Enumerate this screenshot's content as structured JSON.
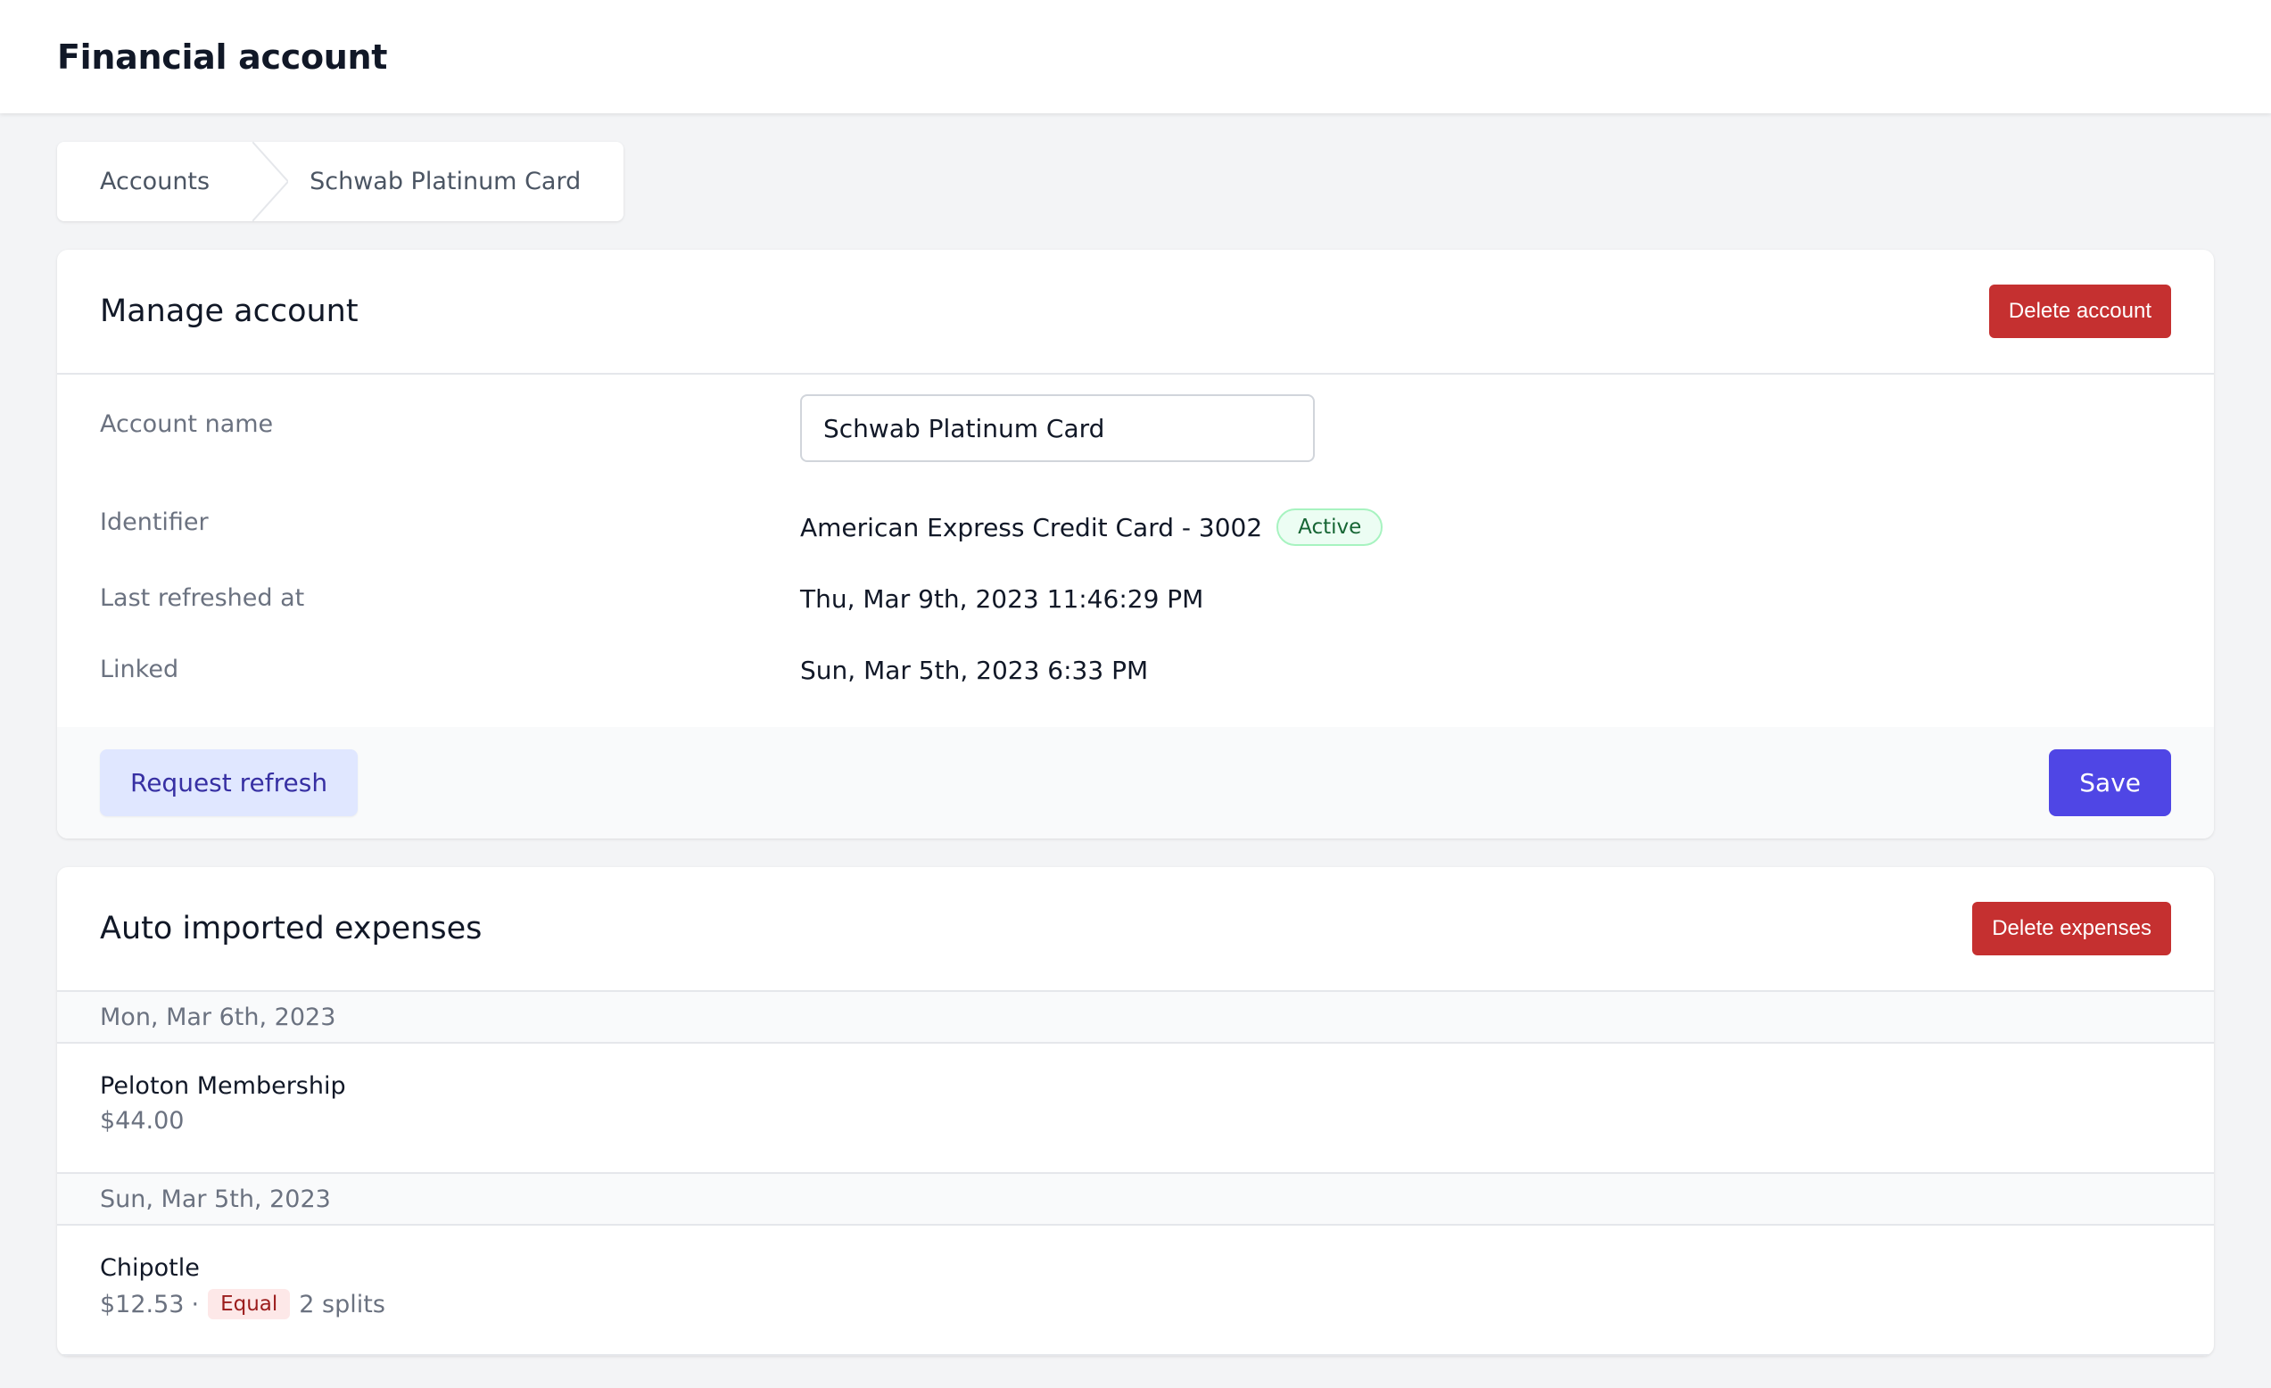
{
  "header": {
    "title": "Financial account"
  },
  "breadcrumb": {
    "items": [
      "Accounts",
      "Schwab Platinum Card"
    ]
  },
  "manage": {
    "title": "Manage account",
    "delete_label": "Delete account",
    "fields": {
      "account_name_label": "Account name",
      "account_name_value": "Schwab Platinum Card",
      "identifier_label": "Identifier",
      "identifier_value": "American Express Credit Card - 3002",
      "status_badge": "Active",
      "last_refreshed_label": "Last refreshed at",
      "last_refreshed_value": "Thu, Mar 9th, 2023 11:46:29 PM",
      "linked_label": "Linked",
      "linked_value": "Sun, Mar 5th, 2023 6:33 PM"
    },
    "request_refresh_label": "Request refresh",
    "save_label": "Save"
  },
  "expenses": {
    "title": "Auto imported expenses",
    "delete_label": "Delete expenses",
    "groups": [
      {
        "date": "Mon, Mar 6th, 2023",
        "items": [
          {
            "name": "Peloton Membership",
            "amount": "$44.00"
          }
        ]
      },
      {
        "date": "Sun, Mar 5th, 2023",
        "items": [
          {
            "name": "Chipotle",
            "amount": "$12.53",
            "separator": "·",
            "split_type": "Equal",
            "splits": "2 splits"
          }
        ]
      }
    ]
  },
  "colors": {
    "danger": "#c53030",
    "primary": "#4f46e5",
    "soft": "#e0e7ff",
    "active_badge": "#ecfdf3",
    "equal_badge": "#fde8e8"
  }
}
